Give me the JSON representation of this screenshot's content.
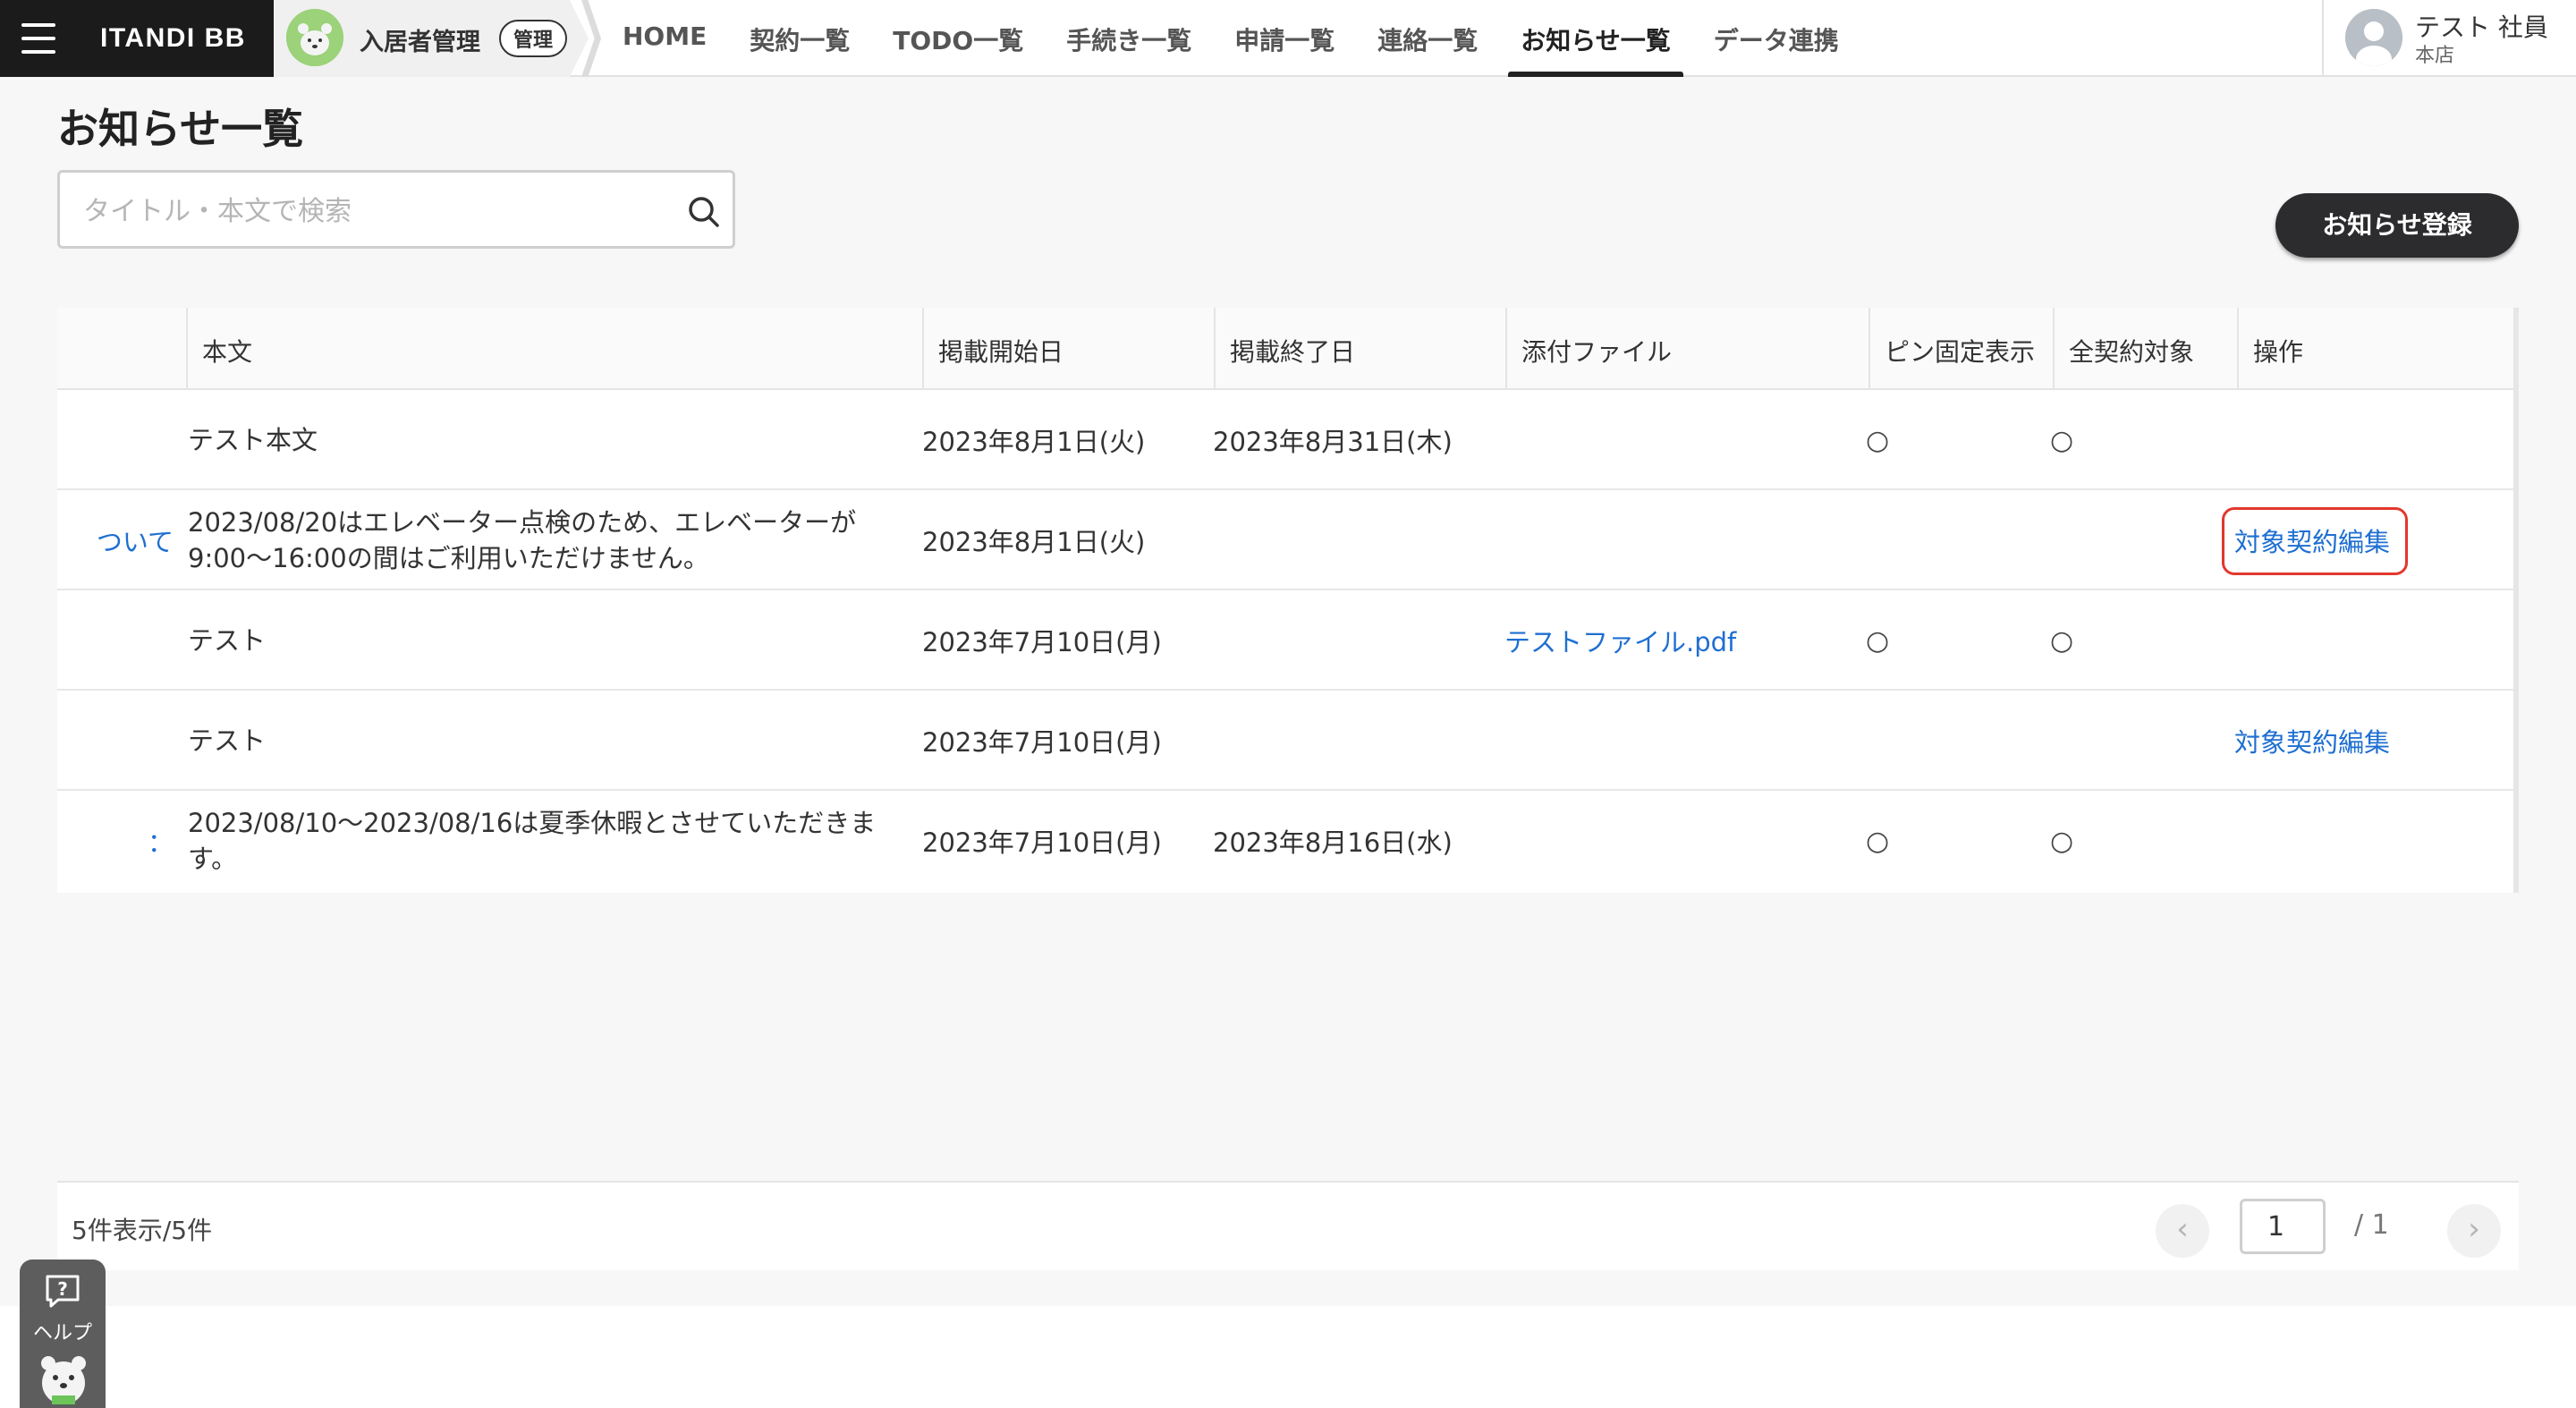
{
  "header": {
    "brand": "ITANDI BB",
    "module": {
      "name": "入居者管理",
      "badge": "管理"
    },
    "nav": [
      {
        "label": "HOME"
      },
      {
        "label": "契約一覧"
      },
      {
        "label": "TODO一覧"
      },
      {
        "label": "手続き一覧"
      },
      {
        "label": "申請一覧"
      },
      {
        "label": "連絡一覧"
      },
      {
        "label": "お知らせ一覧",
        "active": true
      },
      {
        "label": "データ連携"
      }
    ],
    "user": {
      "name": "テスト 社員",
      "branch": "本店"
    }
  },
  "page": {
    "title": "お知らせ一覧",
    "search_placeholder": "タイトル・本文で検索",
    "register_button": "お知らせ登録"
  },
  "table": {
    "columns": [
      "本文",
      "掲載開始日",
      "掲載終了日",
      "添付ファイル",
      "ピン固定表示",
      "全契約対象",
      "操作"
    ],
    "rows": [
      {
        "title": "",
        "body": "テスト本文",
        "start": "2023年8月1日(火)",
        "end": "2023年8月31日(木)",
        "file": "",
        "pin": "○",
        "all": "○",
        "op": ""
      },
      {
        "title": "ついて",
        "body": "2023/08/20はエレベーター点検のため、エレベーターが9:00〜16:00の間はご利用いただけません。",
        "start": "2023年8月1日(火)",
        "end": "",
        "file": "",
        "pin": "",
        "all": "",
        "op": "対象契約編集",
        "op_highlight": true
      },
      {
        "title": "",
        "body": "テスト",
        "start": "2023年7月10日(月)",
        "end": "",
        "file": "テストファイル.pdf",
        "pin": "○",
        "all": "○",
        "op": ""
      },
      {
        "title": "",
        "body": "テスト",
        "start": "2023年7月10日(月)",
        "end": "",
        "file": "",
        "pin": "",
        "all": "",
        "op": "対象契約編集"
      },
      {
        "title": "：",
        "body": "2023/08/10〜2023/08/16は夏季休暇とさせていただきます。",
        "start": "2023年7月10日(月)",
        "end": "2023年8月16日(水)",
        "file": "",
        "pin": "○",
        "all": "○",
        "op": ""
      }
    ]
  },
  "footer": {
    "count_text": "5件表示/5件",
    "prev_icon": "‹",
    "next_icon": "›",
    "current_page": "1",
    "total_pages_text": "/ 1"
  },
  "help": {
    "label": "ヘルプ",
    "icon": "question-bubble-icon"
  },
  "colors": {
    "link": "#1f6fd1",
    "highlight": "#e2382d",
    "brand_bg": "#1b1b1b",
    "button_bg": "#2c2c2e"
  }
}
